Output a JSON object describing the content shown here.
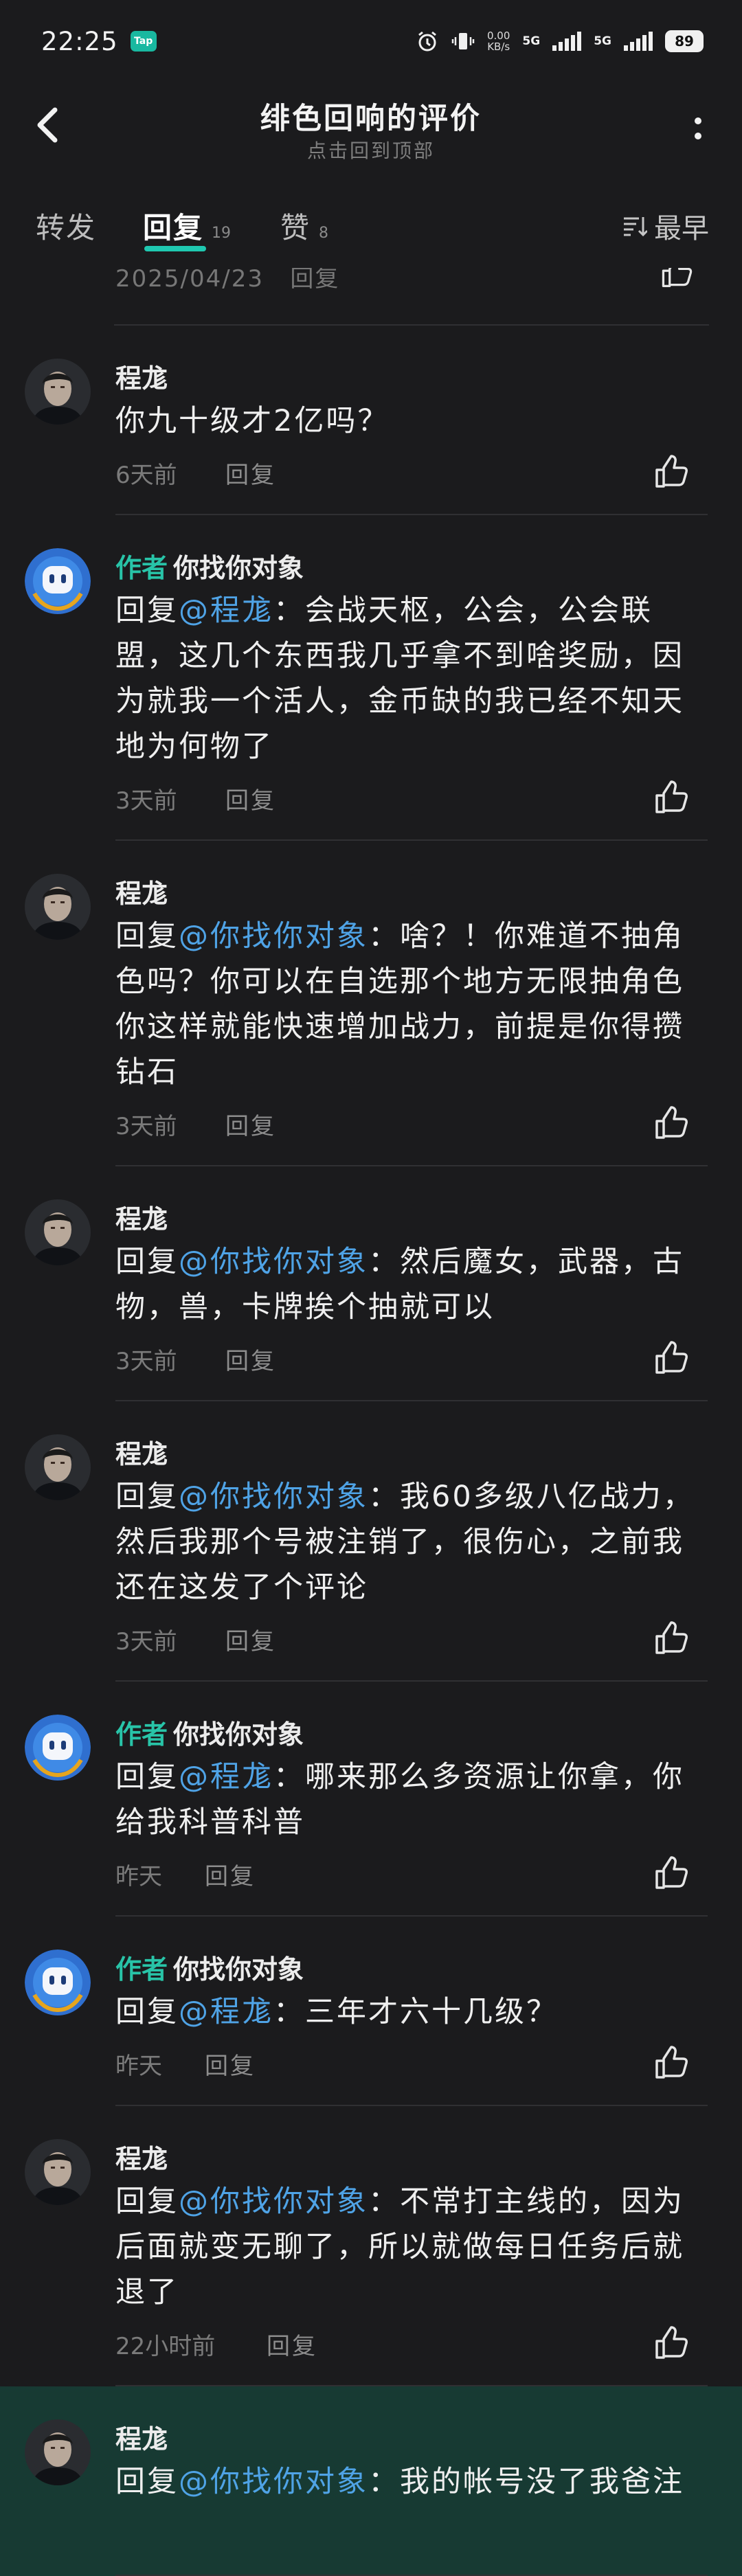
{
  "status": {
    "time": "22:25",
    "app_badge": "Tap",
    "net_speed": "0.00",
    "net_unit": "KB/s",
    "sig1": "5G",
    "sig2": "5G",
    "battery": "89"
  },
  "nav": {
    "title": "绯色回响的评价",
    "subtitle": "点击回到顶部"
  },
  "tabs": [
    {
      "label": "转发",
      "count": ""
    },
    {
      "label": "回复",
      "count": "19"
    },
    {
      "label": "赞",
      "count": "8"
    }
  ],
  "sort_label": "最早",
  "partial": {
    "date": "2025/04/23",
    "reply": "回复"
  },
  "reply_label": "回复",
  "reply_prefix": "回复",
  "author_tag": "作者",
  "comments": [
    {
      "user": "程尨",
      "avatar": "photo",
      "is_author": false,
      "mention": "",
      "text": "你九十级才2亿吗？",
      "time": "6天前"
    },
    {
      "user": "你找你对象",
      "avatar": "robot",
      "is_author": true,
      "mention": "@程尨",
      "text": "：会战天枢，公会，公会联盟，这几个东西我几乎拿不到啥奖励，因为就我一个活人，金币缺的我已经不知天地为何物了",
      "time": "3天前"
    },
    {
      "user": "程尨",
      "avatar": "photo",
      "is_author": false,
      "mention": "@你找你对象",
      "text": "：啥？！你难道不抽角色吗？你可以在自选那个地方无限抽角色你这样就能快速增加战力，前提是你得攒钻石",
      "time": "3天前"
    },
    {
      "user": "程尨",
      "avatar": "photo",
      "is_author": false,
      "mention": "@你找你对象",
      "text": "：然后魔女，武器，古物，兽，卡牌挨个抽就可以",
      "time": "3天前"
    },
    {
      "user": "程尨",
      "avatar": "photo",
      "is_author": false,
      "mention": "@你找你对象",
      "text": "：我60多级八亿战力，然后我那个号被注销了，很伤心，之前我还在这发了个评论",
      "time": "3天前"
    },
    {
      "user": "你找你对象",
      "avatar": "robot",
      "is_author": true,
      "mention": "@程尨",
      "text": "：哪来那么多资源让你拿，你给我科普科普",
      "time": "昨天"
    },
    {
      "user": "你找你对象",
      "avatar": "robot",
      "is_author": true,
      "mention": "@程尨",
      "text": "：三年才六十几级？",
      "time": "昨天"
    },
    {
      "user": "程尨",
      "avatar": "photo",
      "is_author": false,
      "mention": "@你找你对象",
      "text": "：不常打主线的，因为后面就变无聊了，所以就做每日任务后就退了",
      "time": "22小时前"
    },
    {
      "user": "程尨",
      "avatar": "photo",
      "is_author": false,
      "mention": "@你找你对象",
      "text": "：我的帐号没了我爸注",
      "time": "",
      "highlight": true
    }
  ],
  "colors": {
    "accent": "#1fc8b0",
    "mention": "#4fa3e6",
    "background": "#1b1b1d",
    "highlight": "#173a33"
  }
}
